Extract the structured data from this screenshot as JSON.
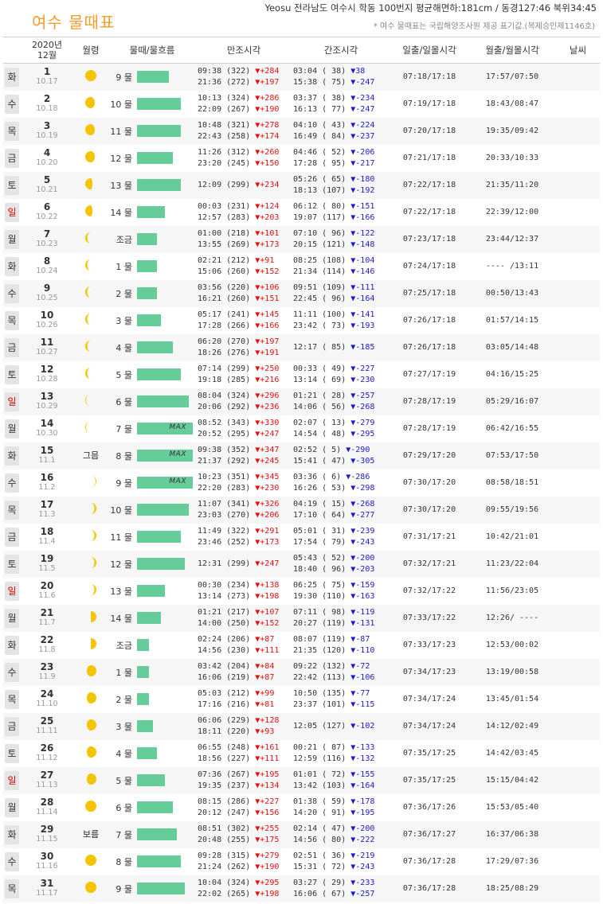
{
  "page": {
    "title": "여수 물때표",
    "location": "Yeosu 전라남도 여수시 학동 100번지 평균해면하:181cm / 동경127:46 북위34:45",
    "note": "* 여수 물때표는 국립해양조사원 제공 표기값.(복제승인제1146호)"
  },
  "headers": {
    "month_year": "2020년",
    "month": "12월",
    "moon": "월령",
    "tide": "물때/물흐름",
    "high": "만조시각",
    "low": "간조시각",
    "sun": "일출/일몰시각",
    "moonrise": "월출/월몰시각",
    "weather": "날씨"
  },
  "colors": {
    "title": "#f29d2b",
    "bar": "#66cc99",
    "rise": "#e01010",
    "fall": "#1a1acc",
    "sunday": "#dd0000"
  },
  "rows": [
    {
      "dow": "화",
      "day": "1",
      "lunar": "10.17",
      "moon_phase": "full",
      "moon_label": "",
      "tide": "9 물",
      "tide_level": 0.47,
      "max": "",
      "high1": "09:38 (322)",
      "high1_d": "▼+284",
      "high2": "21:36 (272)",
      "high2_d": "▼+197",
      "low1": "03:04 ( 38)",
      "low1_d": "▼38",
      "low2": "15:38 ( 75)",
      "low2_d": "▼-247",
      "sun": "07:18/17:18",
      "moon": "17:57/07:50"
    },
    {
      "dow": "수",
      "day": "2",
      "lunar": "10.18",
      "moon_phase": "waning-gibbous",
      "moon_label": "",
      "tide": "10 물",
      "tide_level": 0.65,
      "max": "",
      "high1": "10:13 (324)",
      "high1_d": "▼+286",
      "high2": "22:09 (267)",
      "high2_d": "▼+190",
      "low1": "03:37 ( 38)",
      "low1_d": "▼-234",
      "low2": "16:13 ( 77)",
      "low2_d": "▼-247",
      "sun": "07:19/17:18",
      "moon": "18:43/08:47"
    },
    {
      "dow": "목",
      "day": "3",
      "lunar": "10.19",
      "moon_phase": "waning-gibbous",
      "moon_label": "",
      "tide": "11 물",
      "tide_level": 0.65,
      "max": "",
      "high1": "10:48 (321)",
      "high1_d": "▼+278",
      "high2": "22:43 (258)",
      "high2_d": "▼+174",
      "low1": "04:10 ( 43)",
      "low1_d": "▼-224",
      "low2": "16:49 ( 84)",
      "low2_d": "▼-237",
      "sun": "07:20/17:18",
      "moon": "19:35/09:42"
    },
    {
      "dow": "금",
      "day": "4",
      "lunar": "10.20",
      "moon_phase": "waning-gibbous",
      "moon_label": "",
      "tide": "12 물",
      "tide_level": 0.53,
      "max": "",
      "high1": "11:26 (312)",
      "high1_d": "▼+260",
      "high2": "23:20 (245)",
      "high2_d": "▼+150",
      "low1": "04:46 ( 52)",
      "low1_d": "▼-206",
      "low2": "17:28 ( 95)",
      "low2_d": "▼-217",
      "sun": "07:21/17:18",
      "moon": "20:33/10:33"
    },
    {
      "dow": "토",
      "day": "5",
      "lunar": "10.21",
      "moon_phase": "last-quarter",
      "moon_label": "",
      "tide": "13 물",
      "tide_level": 0.65,
      "max": "",
      "high1": "12:09 (299)",
      "high1_d": "▼+234",
      "high2": "",
      "high2_d": "",
      "low1": "05:26 ( 65)",
      "low1_d": "▼-180",
      "low2": "18:13 (107)",
      "low2_d": "▼-192",
      "sun": "07:22/17:18",
      "moon": "21:35/11:20"
    },
    {
      "dow": "일",
      "day": "6",
      "lunar": "10.22",
      "moon_phase": "last-quarter",
      "moon_label": "",
      "tide": "14 물",
      "tide_level": 0.41,
      "max": "",
      "high1": "00:03 (231)",
      "high1_d": "▼+124",
      "high2": "12:57 (283)",
      "high2_d": "▼+203",
      "low1": "06:12 ( 80)",
      "low1_d": "▼-151",
      "low2": "19:07 (117)",
      "low2_d": "▼-166",
      "sun": "07:22/17:18",
      "moon": "22:39/12:00"
    },
    {
      "dow": "월",
      "day": "7",
      "lunar": "10.23",
      "moon_phase": "waning-crescent",
      "moon_label": "",
      "tide": "조금",
      "tide_level": 0.29,
      "max": "",
      "high1": "01:00 (218)",
      "high1_d": "▼+101",
      "high2": "13:55 (269)",
      "high2_d": "▼+173",
      "low1": "07:10 ( 96)",
      "low1_d": "▼-122",
      "low2": "20:15 (121)",
      "low2_d": "▼-148",
      "sun": "07:23/17:18",
      "moon": "23:44/12:37"
    },
    {
      "dow": "화",
      "day": "8",
      "lunar": "10.24",
      "moon_phase": "waning-crescent",
      "moon_label": "",
      "tide": "1 물",
      "tide_level": 0.29,
      "max": "",
      "high1": "02:21 (212)",
      "high1_d": "▼+91",
      "high2": "15:06 (260)",
      "high2_d": "▼+152",
      "low1": "08:25 (108)",
      "low1_d": "▼-104",
      "low2": "21:34 (114)",
      "low2_d": "▼-146",
      "sun": "07:24/17:18",
      "moon": "---- /13:11"
    },
    {
      "dow": "수",
      "day": "9",
      "lunar": "10.25",
      "moon_phase": "waning-crescent",
      "moon_label": "",
      "tide": "2 물",
      "tide_level": 0.29,
      "max": "",
      "high1": "03:56 (220)",
      "high1_d": "▼+106",
      "high2": "16:21 (260)",
      "high2_d": "▼+151",
      "low1": "09:51 (109)",
      "low1_d": "▼-111",
      "low2": "22:45 ( 96)",
      "low2_d": "▼-164",
      "sun": "07:25/17:18",
      "moon": "00:50/13:43"
    },
    {
      "dow": "목",
      "day": "10",
      "lunar": "10.26",
      "moon_phase": "waning-crescent",
      "moon_label": "",
      "tide": "3 물",
      "tide_level": 0.35,
      "max": "",
      "high1": "05:17 (241)",
      "high1_d": "▼+145",
      "high2": "17:28 (266)",
      "high2_d": "▼+166",
      "low1": "11:11 (100)",
      "low1_d": "▼-141",
      "low2": "23:42 ( 73)",
      "low2_d": "▼-193",
      "sun": "07:26/17:18",
      "moon": "01:57/14:15"
    },
    {
      "dow": "금",
      "day": "11",
      "lunar": "10.27",
      "moon_phase": "waning-crescent",
      "moon_label": "",
      "tide": "4 물",
      "tide_level": 0.53,
      "max": "",
      "high1": "06:20 (270)",
      "high1_d": "▼+197",
      "high2": "18:26 (276)",
      "high2_d": "▼+191",
      "low1": "12:17 ( 85)",
      "low1_d": "▼-185",
      "low2": "",
      "low2_d": "",
      "sun": "07:26/17:18",
      "moon": "03:05/14:48"
    },
    {
      "dow": "토",
      "day": "12",
      "lunar": "10.28",
      "moon_phase": "waning-crescent",
      "moon_label": "",
      "tide": "5 물",
      "tide_level": 0.65,
      "max": "",
      "high1": "07:14 (299)",
      "high1_d": "▼+250",
      "high2": "19:18 (285)",
      "high2_d": "▼+216",
      "low1": "00:33 ( 49)",
      "low1_d": "▼-227",
      "low2": "13:14 ( 69)",
      "low2_d": "▼-230",
      "sun": "07:27/17:19",
      "moon": "04:16/15:25"
    },
    {
      "dow": "일",
      "day": "13",
      "lunar": "10.29",
      "moon_phase": "thin-waning",
      "moon_label": "",
      "tide": "6 물",
      "tide_level": 0.76,
      "max": "",
      "high1": "08:04 (324)",
      "high1_d": "▼+296",
      "high2": "20:06 (292)",
      "high2_d": "▼+236",
      "low1": "01:21 ( 28)",
      "low1_d": "▼-257",
      "low2": "14:06 ( 56)",
      "low2_d": "▼-268",
      "sun": "07:28/17:19",
      "moon": "05:29/16:07"
    },
    {
      "dow": "월",
      "day": "14",
      "lunar": "10.30",
      "moon_phase": "thin-waning",
      "moon_label": "",
      "tide": "7 물",
      "tide_level": 0.82,
      "max": "MAX",
      "high1": "08:52 (343)",
      "high1_d": "▼+330",
      "high2": "20:52 (295)",
      "high2_d": "▼+247",
      "low1": "02:07 ( 13)",
      "low1_d": "▼-279",
      "low2": "14:54 ( 48)",
      "low2_d": "▼-295",
      "sun": "07:28/17:19",
      "moon": "06:42/16:55"
    },
    {
      "dow": "화",
      "day": "15",
      "lunar": "11.1",
      "moon_phase": "new",
      "moon_label": "그믐",
      "tide": "8 물",
      "tide_level": 0.82,
      "max": "MAX",
      "high1": "09:38 (352)",
      "high1_d": "▼+347",
      "high2": "21:37 (292)",
      "high2_d": "▼+245",
      "low1": "02:52 ( 5)",
      "low1_d": "▼-290",
      "low2": "15:41 ( 47)",
      "low2_d": "▼-305",
      "sun": "07:29/17:20",
      "moon": "07:53/17:50"
    },
    {
      "dow": "수",
      "day": "16",
      "lunar": "11.2",
      "moon_phase": "thin-waxing",
      "moon_label": "",
      "tide": "9 물",
      "tide_level": 0.82,
      "max": "MAX",
      "high1": "10:23 (351)",
      "high1_d": "▼+345",
      "high2": "22:20 (283)",
      "high2_d": "▼+230",
      "low1": "03:36 ( 6)",
      "low1_d": "▼-286",
      "low2": "16:26 ( 53)",
      "low2_d": "▼-298",
      "sun": "07:30/17:20",
      "moon": "08:58/18:51"
    },
    {
      "dow": "목",
      "day": "17",
      "lunar": "11.3",
      "moon_phase": "waxing-crescent",
      "moon_label": "",
      "tide": "10 물",
      "tide_level": 0.76,
      "max": "",
      "high1": "11:07 (341)",
      "high1_d": "▼+326",
      "high2": "23:03 (270)",
      "high2_d": "▼+206",
      "low1": "04:19 ( 15)",
      "low1_d": "▼-268",
      "low2": "17:10 ( 64)",
      "low2_d": "▼-277",
      "sun": "07:30/17:20",
      "moon": "09:55/19:56"
    },
    {
      "dow": "금",
      "day": "18",
      "lunar": "11.4",
      "moon_phase": "waxing-crescent",
      "moon_label": "",
      "tide": "11 물",
      "tide_level": 0.65,
      "max": "",
      "high1": "11:49 (322)",
      "high1_d": "▼+291",
      "high2": "23:46 (252)",
      "high2_d": "▼+173",
      "low1": "05:01 ( 31)",
      "low1_d": "▼-239",
      "low2": "17:54 ( 79)",
      "low2_d": "▼-243",
      "sun": "07:31/17:21",
      "moon": "10:42/21:01"
    },
    {
      "dow": "토",
      "day": "19",
      "lunar": "11.5",
      "moon_phase": "waxing-crescent",
      "moon_label": "",
      "tide": "12 물",
      "tide_level": 0.71,
      "max": "",
      "high1": "12:31 (299)",
      "high1_d": "▼+247",
      "high2": "",
      "high2_d": "",
      "low1": "05:43 ( 52)",
      "low1_d": "▼-200",
      "low2": "18:40 ( 96)",
      "low2_d": "▼-203",
      "sun": "07:32/17:21",
      "moon": "11:23/22:04"
    },
    {
      "dow": "일",
      "day": "20",
      "lunar": "11.6",
      "moon_phase": "waxing-crescent",
      "moon_label": "",
      "tide": "13 물",
      "tide_level": 0.41,
      "max": "",
      "high1": "00:30 (234)",
      "high1_d": "▼+138",
      "high2": "13:14 (273)",
      "high2_d": "▼+198",
      "low1": "06:25 ( 75)",
      "low1_d": "▼-159",
      "low2": "19:30 (110)",
      "low2_d": "▼-163",
      "sun": "07:32/17:22",
      "moon": "11:56/23:05"
    },
    {
      "dow": "월",
      "day": "21",
      "lunar": "11.7",
      "moon_phase": "first-quarter",
      "moon_label": "",
      "tide": "14 물",
      "tide_level": 0.35,
      "max": "",
      "high1": "01:21 (217)",
      "high1_d": "▼+107",
      "high2": "14:00 (250)",
      "high2_d": "▼+152",
      "low1": "07:11 ( 98)",
      "low1_d": "▼-119",
      "low2": "20:27 (119)",
      "low2_d": "▼-131",
      "sun": "07:33/17:22",
      "moon": "12:26/ ----"
    },
    {
      "dow": "화",
      "day": "22",
      "lunar": "11.8",
      "moon_phase": "first-quarter",
      "moon_label": "",
      "tide": "조금",
      "tide_level": 0.18,
      "max": "",
      "high1": "02:24 (206)",
      "high1_d": "▼+87",
      "high2": "14:56 (230)",
      "high2_d": "▼+111",
      "low1": "08:07 (119)",
      "low1_d": "▼-87",
      "low2": "21:35 (120)",
      "low2_d": "▼-110",
      "sun": "07:33/17:23",
      "moon": "12:53/00:02"
    },
    {
      "dow": "수",
      "day": "23",
      "lunar": "11.9",
      "moon_phase": "waxing-gibbous",
      "moon_label": "",
      "tide": "1 물",
      "tide_level": 0.18,
      "max": "",
      "high1": "03:42 (204)",
      "high1_d": "▼+84",
      "high2": "16:06 (219)",
      "high2_d": "▼+87",
      "low1": "09:22 (132)",
      "low1_d": "▼-72",
      "low2": "22:42 (113)",
      "low2_d": "▼-106",
      "sun": "07:34/17:23",
      "moon": "13:19/00:58"
    },
    {
      "dow": "목",
      "day": "24",
      "lunar": "11.10",
      "moon_phase": "waxing-gibbous",
      "moon_label": "",
      "tide": "2 물",
      "tide_level": 0.18,
      "max": "",
      "high1": "05:03 (212)",
      "high1_d": "▼+99",
      "high2": "17:16 (216)",
      "high2_d": "▼+81",
      "low1": "10:50 (135)",
      "low1_d": "▼-77",
      "low2": "23:37 (101)",
      "low2_d": "▼-115",
      "sun": "07:34/17:24",
      "moon": "13:45/01:54"
    },
    {
      "dow": "금",
      "day": "25",
      "lunar": "11.11",
      "moon_phase": "waxing-gibbous",
      "moon_label": "",
      "tide": "3 물",
      "tide_level": 0.24,
      "max": "",
      "high1": "06:06 (229)",
      "high1_d": "▼+128",
      "high2": "18:11 (220)",
      "high2_d": "▼+93",
      "low1": "12:05 (127)",
      "low1_d": "▼-102",
      "low2": "",
      "low2_d": "",
      "sun": "07:34/17:24",
      "moon": "14:12/02:49"
    },
    {
      "dow": "토",
      "day": "26",
      "lunar": "11.12",
      "moon_phase": "waxing-gibbous",
      "moon_label": "",
      "tide": "4 물",
      "tide_level": 0.29,
      "max": "",
      "high1": "06:55 (248)",
      "high1_d": "▼+161",
      "high2": "18:56 (227)",
      "high2_d": "▼+111",
      "low1": "00:21 ( 87)",
      "low1_d": "▼-133",
      "low2": "12:59 (116)",
      "low2_d": "▼-132",
      "sun": "07:35/17:25",
      "moon": "14:42/03:45"
    },
    {
      "dow": "일",
      "day": "27",
      "lunar": "11.13",
      "moon_phase": "waxing-gibbous",
      "moon_label": "",
      "tide": "5 물",
      "tide_level": 0.41,
      "max": "",
      "high1": "07:36 (267)",
      "high1_d": "▼+195",
      "high2": "19:35 (237)",
      "high2_d": "▼+134",
      "low1": "01:01 ( 72)",
      "low1_d": "▼-155",
      "low2": "13:42 (103)",
      "low2_d": "▼-164",
      "sun": "07:35/17:25",
      "moon": "15:15/04:42"
    },
    {
      "dow": "월",
      "day": "28",
      "lunar": "11.14",
      "moon_phase": "full",
      "moon_label": "",
      "tide": "6 물",
      "tide_level": 0.53,
      "max": "",
      "high1": "08:15 (286)",
      "high1_d": "▼+227",
      "high2": "20:12 (247)",
      "high2_d": "▼+156",
      "low1": "01:38 ( 59)",
      "low1_d": "▼-178",
      "low2": "14:20 ( 91)",
      "low2_d": "▼-195",
      "sun": "07:36/17:26",
      "moon": "15:53/05:40"
    },
    {
      "dow": "화",
      "day": "29",
      "lunar": "11.15",
      "moon_phase": "full",
      "moon_label": "보름",
      "tide": "7 물",
      "tide_level": 0.59,
      "max": "",
      "high1": "08:51 (302)",
      "high1_d": "▼+255",
      "high2": "20:48 (255)",
      "high2_d": "▼+175",
      "low1": "02:14 ( 47)",
      "low1_d": "▼-200",
      "low2": "14:56 ( 80)",
      "low2_d": "▼-222",
      "sun": "07:36/17:27",
      "moon": "16:37/06:38"
    },
    {
      "dow": "수",
      "day": "30",
      "lunar": "11.16",
      "moon_phase": "full",
      "moon_label": "",
      "tide": "8 물",
      "tide_level": 0.65,
      "max": "",
      "high1": "09:28 (315)",
      "high1_d": "▼+279",
      "high2": "21:24 (262)",
      "high2_d": "▼+190",
      "low1": "02:51 ( 36)",
      "low1_d": "▼-219",
      "low2": "15:31 ( 72)",
      "low2_d": "▼-243",
      "sun": "07:36/17:28",
      "moon": "17:29/07:36"
    },
    {
      "dow": "목",
      "day": "31",
      "lunar": "11.17",
      "moon_phase": "full",
      "moon_label": "",
      "tide": "9 물",
      "tide_level": 0.71,
      "max": "",
      "high1": "10:04 (324)",
      "high1_d": "▼+295",
      "high2": "22:02 (265)",
      "high2_d": "▼+198",
      "low1": "03:27 ( 29)",
      "low1_d": "▼-233",
      "low2": "16:06 ( 67)",
      "low2_d": "▼-257",
      "sun": "07:36/17:28",
      "moon": "18:25/08:29"
    }
  ]
}
